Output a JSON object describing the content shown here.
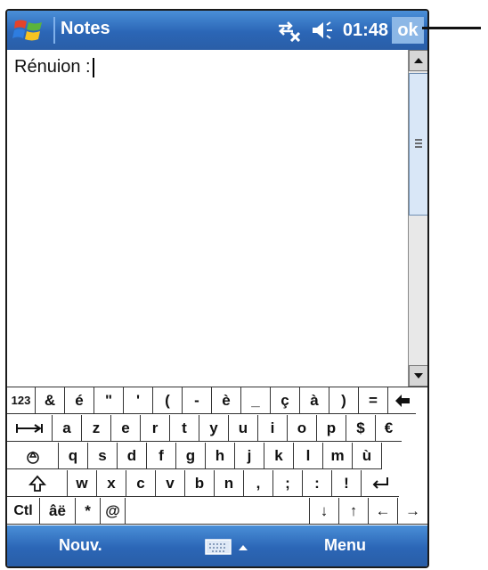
{
  "titlebar": {
    "app_title": "Notes",
    "time": "01:48",
    "ok_label": "ok",
    "icons": [
      "windows-start-icon",
      "connectivity-off-icon",
      "volume-icon"
    ]
  },
  "note": {
    "text": "Rénuion :"
  },
  "keyboard": {
    "rows": [
      [
        "123",
        "&",
        "é",
        "\"",
        "'",
        "(",
        "-",
        "è",
        "_",
        "ç",
        "à",
        ")",
        "=",
        "◀"
      ],
      [
        "⇥",
        "a",
        "z",
        "e",
        "r",
        "t",
        "y",
        "u",
        "i",
        "o",
        "p",
        "$",
        "€"
      ],
      [
        "⇪",
        "q",
        "s",
        "d",
        "f",
        "g",
        "h",
        "j",
        "k",
        "l",
        "m",
        "ù"
      ],
      [
        "⇧",
        "w",
        "x",
        "c",
        "v",
        "b",
        "n",
        ",",
        ";",
        ":",
        "!",
        "↵"
      ],
      [
        "Ctl",
        "âë",
        "*",
        "@",
        " ",
        "↓",
        "↑",
        "←",
        "→"
      ]
    ]
  },
  "menubar": {
    "left_label": "Nouv.",
    "right_label": "Menu",
    "sip_icon": "keyboard-icon"
  },
  "colors": {
    "bar_blue": "#2b66b6",
    "bar_blue_light": "#4a8fd8",
    "ok_button": "#8cb7e6"
  }
}
